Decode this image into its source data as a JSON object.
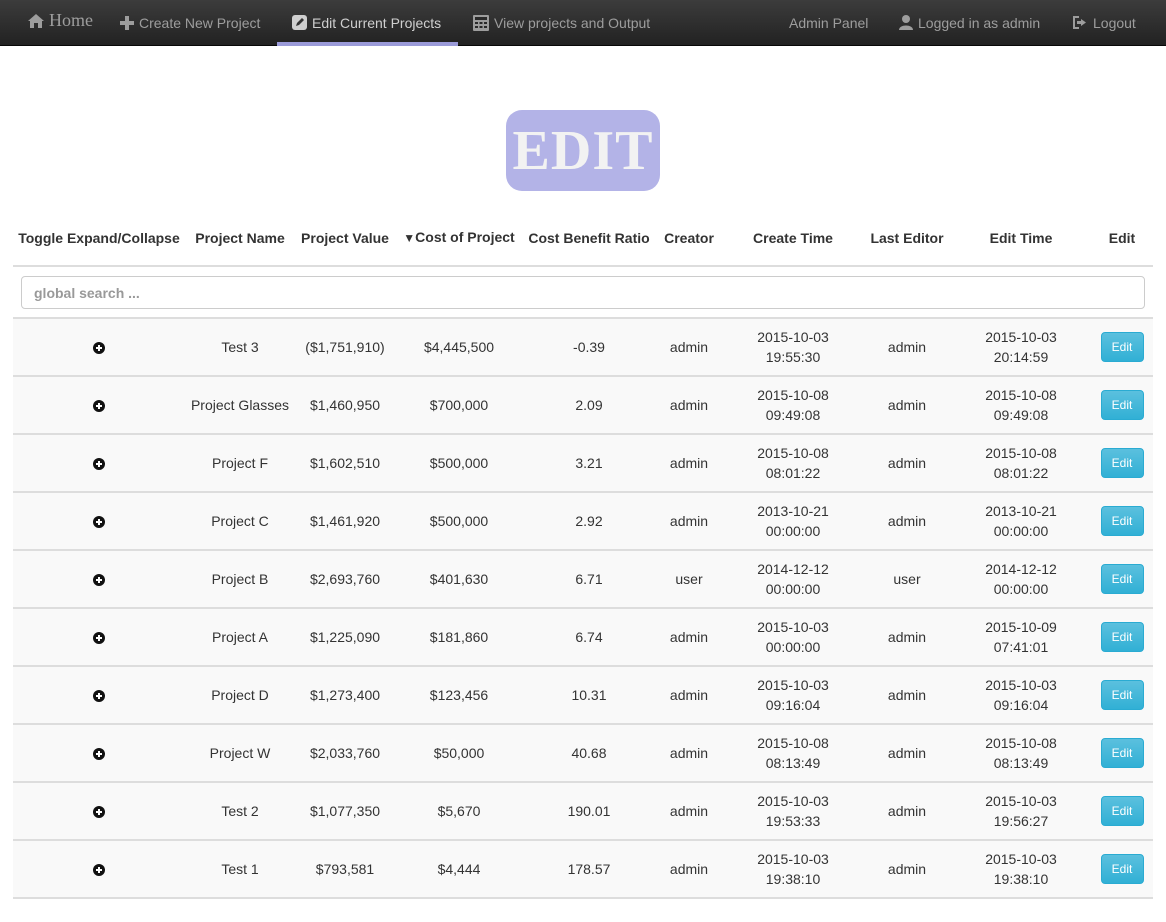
{
  "nav": {
    "home": "Home",
    "create": "Create New Project",
    "edit": "Edit Current Projects",
    "view": "View projects and Output",
    "admin": "Admin Panel",
    "logged_in": "Logged in as admin",
    "logout": "Logout"
  },
  "logo_text": "EDIT",
  "columns": {
    "toggle": "Toggle Expand/Collapse",
    "name": "Project Name",
    "value": "Project Value",
    "cost_arrow": "▼",
    "cost": "Cost of Project",
    "ratio": "Cost Benefit Ratio",
    "creator": "Creator",
    "create_time": "Create Time",
    "last_editor": "Last Editor",
    "edit_time": "Edit Time",
    "edit": "Edit"
  },
  "search": {
    "placeholder": "global search ..."
  },
  "edit_label": "Edit",
  "rows": [
    {
      "name": "Test 3",
      "value": "($1,751,910)",
      "cost": "$4,445,500",
      "ratio": "-0.39",
      "creator": "admin",
      "create_date": "2015-10-03",
      "create_clock": "19:55:30",
      "editor": "admin",
      "edit_date": "2015-10-03",
      "edit_clock": "20:14:59"
    },
    {
      "name": "Project Glasses",
      "value": "$1,460,950",
      "cost": "$700,000",
      "ratio": "2.09",
      "creator": "admin",
      "create_date": "2015-10-08",
      "create_clock": "09:49:08",
      "editor": "admin",
      "edit_date": "2015-10-08",
      "edit_clock": "09:49:08"
    },
    {
      "name": "Project F",
      "value": "$1,602,510",
      "cost": "$500,000",
      "ratio": "3.21",
      "creator": "admin",
      "create_date": "2015-10-08",
      "create_clock": "08:01:22",
      "editor": "admin",
      "edit_date": "2015-10-08",
      "edit_clock": "08:01:22"
    },
    {
      "name": "Project C",
      "value": "$1,461,920",
      "cost": "$500,000",
      "ratio": "2.92",
      "creator": "admin",
      "create_date": "2013-10-21",
      "create_clock": "00:00:00",
      "editor": "admin",
      "edit_date": "2013-10-21",
      "edit_clock": "00:00:00"
    },
    {
      "name": "Project B",
      "value": "$2,693,760",
      "cost": "$401,630",
      "ratio": "6.71",
      "creator": "user",
      "create_date": "2014-12-12",
      "create_clock": "00:00:00",
      "editor": "user",
      "edit_date": "2014-12-12",
      "edit_clock": "00:00:00"
    },
    {
      "name": "Project A",
      "value": "$1,225,090",
      "cost": "$181,860",
      "ratio": "6.74",
      "creator": "admin",
      "create_date": "2015-10-03",
      "create_clock": "00:00:00",
      "editor": "admin",
      "edit_date": "2015-10-09",
      "edit_clock": "07:41:01"
    },
    {
      "name": "Project D",
      "value": "$1,273,400",
      "cost": "$123,456",
      "ratio": "10.31",
      "creator": "admin",
      "create_date": "2015-10-03",
      "create_clock": "09:16:04",
      "editor": "admin",
      "edit_date": "2015-10-03",
      "edit_clock": "09:16:04"
    },
    {
      "name": "Project W",
      "value": "$2,033,760",
      "cost": "$50,000",
      "ratio": "40.68",
      "creator": "admin",
      "create_date": "2015-10-08",
      "create_clock": "08:13:49",
      "editor": "admin",
      "edit_date": "2015-10-08",
      "edit_clock": "08:13:49"
    },
    {
      "name": "Test 2",
      "value": "$1,077,350",
      "cost": "$5,670",
      "ratio": "190.01",
      "creator": "admin",
      "create_date": "2015-10-03",
      "create_clock": "19:53:33",
      "editor": "admin",
      "edit_date": "2015-10-03",
      "edit_clock": "19:56:27"
    },
    {
      "name": "Test 1",
      "value": "$793,581",
      "cost": "$4,444",
      "ratio": "178.57",
      "creator": "admin",
      "create_date": "2015-10-03",
      "create_clock": "19:38:10",
      "editor": "admin",
      "edit_date": "2015-10-03",
      "edit_clock": "19:38:10"
    }
  ]
}
